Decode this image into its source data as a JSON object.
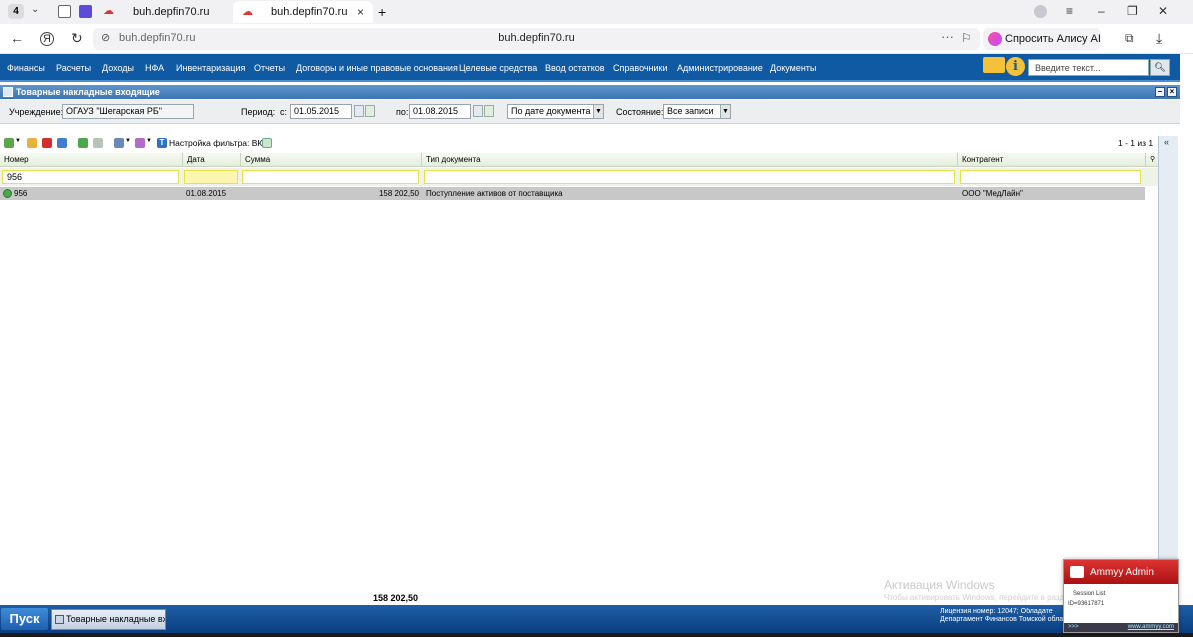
{
  "browser": {
    "tab_count": "4",
    "tabs": [
      {
        "title": "buh.depfin70.ru",
        "active": false
      },
      {
        "title": "buh.depfin70.ru",
        "active": true
      }
    ],
    "new_tab": "+",
    "url_small": "buh.depfin70.ru",
    "url_title": "buh.depfin70.ru",
    "more": "···",
    "alice_label": "Спросить Алису AI"
  },
  "menu": {
    "items": [
      "Финансы",
      "Расчеты",
      "Доходы",
      "НФА",
      "Инвентаризация",
      "Отчеты",
      "Договоры и иные правовые основания",
      "Целевые средства",
      "Ввод остатков",
      "Справочники",
      "Администрирование",
      "Документы"
    ],
    "search_placeholder": "Введите текст...",
    "info": "i"
  },
  "panel": {
    "title": "Товарные накладные входящие",
    "minimize": "–",
    "close": "×"
  },
  "filters": {
    "institution_label": "Учреждение:",
    "institution_value": "ОГАУЗ \"Шегарская РБ\"",
    "period_label": "Период:",
    "from_label": "с:",
    "from_value": "01.05.2015",
    "to_label": "по:",
    "to_value": "01.08.2015",
    "date_mode": "По дате документа",
    "state_label": "Состояние:",
    "state_value": "Все записи"
  },
  "toolbar": {
    "filter_setting": "Настройка фильтра: ВКЛ",
    "filter_badge": "T",
    "pager": "1 - 1 из 1"
  },
  "grid": {
    "columns": [
      "Номер",
      "Дата",
      "Сумма",
      "Тип документа",
      "Контрагент"
    ],
    "filter_number": "956",
    "rows": [
      {
        "number": "956",
        "date": "01.08.2015",
        "sum": "158 202,50",
        "doc_type": "Поступление активов от поставщика",
        "counterparty": "ООО \"МедЛайн\""
      }
    ],
    "total": "158 202,50"
  },
  "taskbar": {
    "start": "Пуск",
    "task": "Товарные накладные вхо...",
    "license_line1": "Лицензия номер: 12047; Обладате",
    "license_line2": "Департамент Финансов Томской облас"
  },
  "watermark": {
    "line1": "Активация Windows",
    "line2": "Чтобы активировать Windows, перейдите в раздел \"Параметры\"."
  },
  "ammyy": {
    "title": "Ammyy Admin",
    "session": "Session List",
    "id": "ID=93617871",
    "footer_left": ">>>",
    "footer_right": "www.ammyy.com"
  }
}
